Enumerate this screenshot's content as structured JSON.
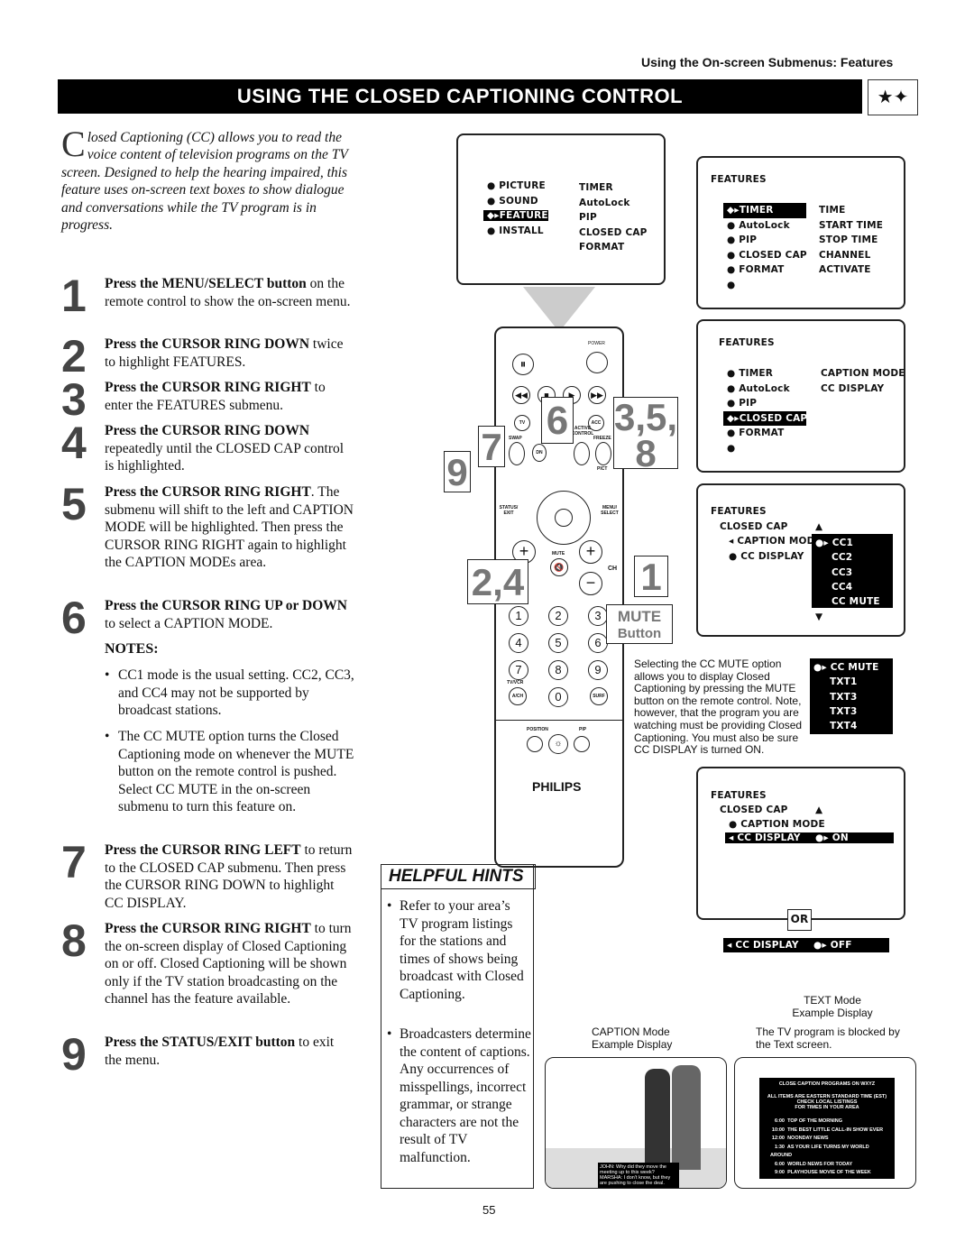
{
  "header": {
    "section": "Using the On-screen Submenus: Features",
    "title": "USING THE CLOSED CAPTIONING CONTROL",
    "icon": "star-burst-icon"
  },
  "intro": {
    "dropcap": "C",
    "text": "losed Captioning (CC) allows you to read the voice content of television programs on the TV screen. Designed to help the hearing impaired, this feature uses on-screen text boxes to show dialogue and conversations while the TV program is in progress."
  },
  "steps": [
    {
      "num": "1",
      "bold": "Press the MENU/SELECT button",
      "text": " on the remote control to show the on-screen menu."
    },
    {
      "num": "2",
      "bold": "Press the CURSOR RING DOWN",
      "text": " twice to highlight FEATURES."
    },
    {
      "num": "3",
      "bold": "Press the CURSOR RING RIGHT",
      "text": " to enter the FEATURES submenu."
    },
    {
      "num": "4",
      "bold": "Press the CURSOR RING DOWN",
      "text": " repeatedly until the CLOSED CAP control is highlighted."
    },
    {
      "num": "5",
      "bold": "Press the CURSOR RING RIGHT",
      "text": ". The submenu will shift to the left and CAPTION MODE will be highlighted. Then press the CURSOR RING RIGHT again to highlight the CAPTION MODEs area."
    },
    {
      "num": "6",
      "bold": "Press the CURSOR RING UP or DOWN",
      "text": " to select a CAPTION MODE."
    },
    {
      "num": "7",
      "bold": "Press the CURSOR RING LEFT",
      "text": " to return to the CLOSED CAP submenu. Then press the CURSOR RING DOWN to highlight CC DISPLAY."
    },
    {
      "num": "8",
      "bold": "Press the CURSOR RING RIGHT",
      "text": " to turn the on-screen display of Closed Captioning on or off. Closed Captioning will be shown only if the TV station broadcasting on the channel has the feature available."
    },
    {
      "num": "9",
      "bold": "Press the STATUS/EXIT button",
      "text": " to exit the menu."
    }
  ],
  "notes": {
    "title": "NOTES:",
    "items": [
      "CC1 mode is the usual setting. CC2, CC3, and CC4 may not be supported by broadcast stations.",
      "The CC MUTE option turns the Closed Captioning mode on whenever the MUTE button on the remote control is pushed. Select CC MUTE in the on-screen submenu to turn this feature on."
    ]
  },
  "hints": {
    "title": "HELPFUL HINTS",
    "items": [
      "Refer to your area’s TV program listings for the stations and times of shows being broadcast with Closed Captioning.",
      "Broadcasters determine the content of captions. Any occurrences of misspellings, incorrect grammar, or strange characters are not the result of TV malfunction."
    ]
  },
  "screens": {
    "main": {
      "left": [
        "PICTURE",
        "SOUND",
        "FEATURES",
        "INSTALL"
      ],
      "right": [
        "TIMER",
        "AutoLock",
        "PIP",
        "CLOSED CAP",
        "FORMAT"
      ]
    },
    "features1": {
      "title": "FEATURES",
      "left": [
        "TIMER",
        "AutoLock",
        "PIP",
        "CLOSED CAP",
        "FORMAT"
      ],
      "right": [
        "TIME",
        "START TIME",
        "STOP TIME",
        "CHANNEL",
        "ACTIVATE"
      ]
    },
    "features2": {
      "title": "FEATURES",
      "left": [
        "TIMER",
        "AutoLock",
        "PIP",
        "CLOSED CAP",
        "FORMAT"
      ],
      "right": [
        "CAPTION MODE",
        "CC DISPLAY"
      ]
    },
    "cc": {
      "title": "FEATURES",
      "sub": "CLOSED CAP",
      "items": [
        "CAPTION MODE",
        "CC DISPLAY"
      ],
      "modes": [
        "CC1",
        "CC2",
        "CC3",
        "CC4",
        "CC MUTE"
      ]
    },
    "ccmute": {
      "modes": [
        "CC MUTE",
        "TXT1",
        "TXT3",
        "TXT3",
        "TXT4"
      ],
      "text": "Selecting the CC MUTE option allows you to display Closed Captioning by pressing the MUTE button on the remote control. Note, however, that the program you are watching must be providing Closed Captioning. You must also be sure CC DISPLAY is turned ON."
    },
    "display": {
      "title": "FEATURES",
      "sub": "CLOSED CAP",
      "items": [
        "CAPTION MODE",
        "CC DISPLAY"
      ],
      "on": "ON",
      "or": "OR",
      "off": "OFF"
    }
  },
  "remote": {
    "labels": [
      "POWER",
      "TV",
      "ACC",
      "SWAP",
      "ACTIVE CONTROL",
      "FREEZE",
      "DN",
      "PICT",
      "STATUS/ EXIT",
      "MENU/ SELECT",
      "MUTE",
      "CH",
      "TV/VCR",
      "A/CH",
      "SURF",
      "POSITION",
      "PIP"
    ],
    "digits": [
      "1",
      "2",
      "3",
      "4",
      "5",
      "6",
      "7",
      "8",
      "9",
      "0"
    ],
    "brand": "PHILIPS",
    "callouts": [
      "6",
      "3,5,",
      "8",
      "7",
      "9",
      "2,4",
      "1"
    ],
    "mute": "MUTE",
    "mute_sub": "Button"
  },
  "examples": {
    "caption": {
      "title": "CAPTION Mode",
      "sub": "Example Display",
      "caption": "JOHN: Why did they move the meeting up to this week? MARSHA: I don’t know, but they are pushing to close the deal."
    },
    "text": {
      "title": "TEXT Mode",
      "sub": "Example Display",
      "desc": "The TV program is blocked by the Text screen.",
      "lines": [
        "CLOSE CAPTION PROGRAMS ON WXYZ",
        "ALL ITEMS ARE EASTERN STANDARD TIME (EST)",
        "CHECK LOCAL LISTINGS",
        "FOR TIMES IN YOUR AREA"
      ],
      "listings": [
        [
          "6:00",
          "TOP OF THE MORNING"
        ],
        [
          "10:00",
          "THE BEST LITTLE CALL-IN SHOW EVER"
        ],
        [
          "12:00",
          "NOONDAY NEWS"
        ],
        [
          "1:30",
          "AS YOUR LIFE TURNS MY WORLD AROUND"
        ],
        [
          "6:00",
          "WORLD NEWS FOR TODAY"
        ],
        [
          "9:00",
          "PLAYHOUSE MOVIE OF THE WEEK"
        ]
      ]
    }
  },
  "page_number": "55"
}
